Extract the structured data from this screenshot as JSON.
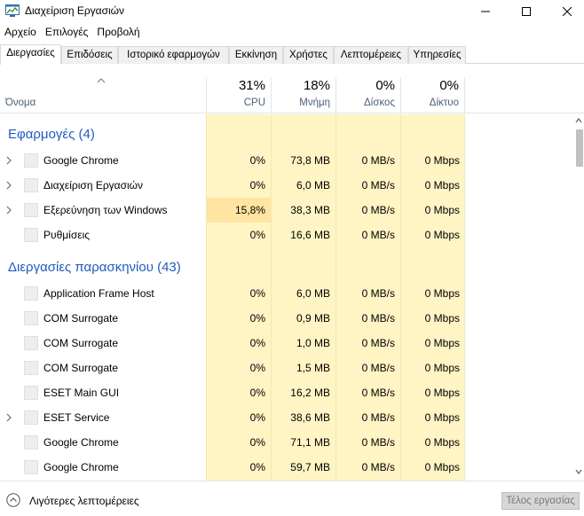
{
  "window": {
    "title": "Διαχείριση Εργασιών"
  },
  "menu": [
    "Αρχείο",
    "Επιλογές",
    "Προβολή"
  ],
  "tabs": [
    "Διεργασίες",
    "Επιδόσεις",
    "Ιστορικό εφαρμογών",
    "Εκκίνηση",
    "Χρήστες",
    "Λεπτομέρειες",
    "Υπηρεσίες"
  ],
  "active_tab": "Διεργασίες",
  "columns": {
    "name": "Όνομα",
    "cpu": {
      "pct": "31%",
      "label": "CPU"
    },
    "memory": {
      "pct": "18%",
      "label": "Μνήμη"
    },
    "disk": {
      "pct": "0%",
      "label": "Δίσκος"
    },
    "network": {
      "pct": "0%",
      "label": "Δίκτυο"
    }
  },
  "groups": [
    {
      "title": "Εφαρμογές (4)",
      "rows": [
        {
          "name": "Google Chrome",
          "expandable": true,
          "cpu": "0%",
          "memory": "73,8 MB",
          "disk": "0 MB/s",
          "network": "0 Mbps"
        },
        {
          "name": "Διαχείριση Εργασιών",
          "expandable": true,
          "cpu": "0%",
          "memory": "6,0 MB",
          "disk": "0 MB/s",
          "network": "0 Mbps"
        },
        {
          "name": "Εξερεύνηση των Windows",
          "expandable": true,
          "cpu": "15,8%",
          "memory": "38,3 MB",
          "disk": "0 MB/s",
          "network": "0 Mbps",
          "cpu_highlight": true
        },
        {
          "name": "Ρυθμίσεις",
          "expandable": false,
          "cpu": "0%",
          "memory": "16,6 MB",
          "disk": "0 MB/s",
          "network": "0 Mbps"
        }
      ]
    },
    {
      "title": "Διεργασίες παρασκηνίου (43)",
      "rows": [
        {
          "name": "Application Frame Host",
          "expandable": false,
          "cpu": "0%",
          "memory": "6,0 MB",
          "disk": "0 MB/s",
          "network": "0 Mbps"
        },
        {
          "name": "COM Surrogate",
          "expandable": false,
          "cpu": "0%",
          "memory": "0,9 MB",
          "disk": "0 MB/s",
          "network": "0 Mbps"
        },
        {
          "name": "COM Surrogate",
          "expandable": false,
          "cpu": "0%",
          "memory": "1,0 MB",
          "disk": "0 MB/s",
          "network": "0 Mbps"
        },
        {
          "name": "COM Surrogate",
          "expandable": false,
          "cpu": "0%",
          "memory": "1,5 MB",
          "disk": "0 MB/s",
          "network": "0 Mbps"
        },
        {
          "name": "ESET Main GUI",
          "expandable": false,
          "cpu": "0%",
          "memory": "16,2 MB",
          "disk": "0 MB/s",
          "network": "0 Mbps"
        },
        {
          "name": "ESET Service",
          "expandable": true,
          "cpu": "0%",
          "memory": "38,6 MB",
          "disk": "0 MB/s",
          "network": "0 Mbps"
        },
        {
          "name": "Google Chrome",
          "expandable": false,
          "cpu": "0%",
          "memory": "71,1 MB",
          "disk": "0 MB/s",
          "network": "0 Mbps"
        },
        {
          "name": "Google Chrome",
          "expandable": false,
          "cpu": "0%",
          "memory": "59,7 MB",
          "disk": "0 MB/s",
          "network": "0 Mbps"
        }
      ]
    }
  ],
  "footer": {
    "less_details": "Λιγότερες λεπτομέρειες",
    "end_task": "Τέλος εργασίας"
  },
  "colors": {
    "cell_bg": "#fff4c4",
    "cpu_highlight_bg": "#ffe5a1",
    "group_title": "#1f5cbf",
    "header_label": "#4c607a"
  }
}
